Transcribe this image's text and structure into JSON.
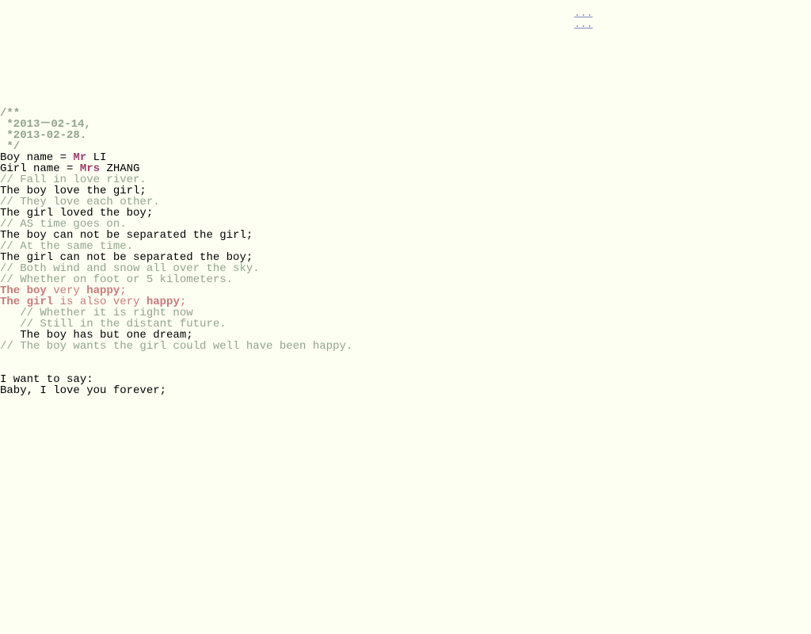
{
  "links": {
    "a": "...",
    "b": "..."
  },
  "block": {
    "c1": "/**",
    "c2": " *2013－02-14,",
    "c3": " *2013-02-28.",
    "c4": " */",
    "l1a": "Boy name = ",
    "l1b": "Mr",
    "l1c": " LI",
    "l2a": "Girl name = ",
    "l2b": "Mrs",
    "l2c": " ZHANG",
    "c5": "// Fall in love river.",
    "l3": "The boy love the girl;",
    "c6": "// They love each other.",
    "l4": "The girl loved the boy;",
    "c7": "// AS time goes on.",
    "l5": "The boy can not be separated the girl;",
    "c8": "// At the same time.",
    "l6": "The girl can not be separated the boy;",
    "c9": "// Both wind and snow all over the sky.",
    "c10": "// Whether on foot or 5 kilometers.",
    "l7a": "The boy",
    "l7b": " very ",
    "l7c": "happy",
    "l7d": ";",
    "l8a": "The girl",
    "l8b": " is also very ",
    "l8c": "happy",
    "l8d": ";",
    "c11": "   // Whether it is right now",
    "c12": "   // Still in the distant future.",
    "l9": "   The boy has but one dream;",
    "c13": "// The boy wants the girl could well have been happy."
  },
  "footer": {
    "f1": "I want to say:",
    "f2": "Baby, I love you forever;"
  }
}
